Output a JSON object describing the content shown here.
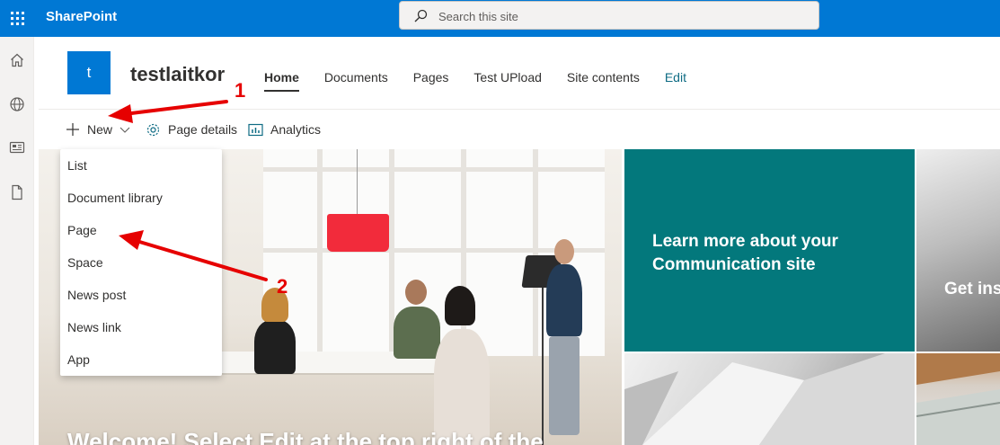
{
  "suitebar": {
    "app_name": "SharePoint",
    "search_placeholder": "Search this site",
    "waffle_icon": "app-launcher-icon"
  },
  "appbar": {
    "items": [
      "home-icon",
      "globe-icon",
      "news-icon",
      "file-icon"
    ]
  },
  "site": {
    "logo_letter": "t",
    "title": "testlaitkor"
  },
  "nav": {
    "items": [
      "Home",
      "Documents",
      "Pages",
      "Test UPload",
      "Site contents"
    ],
    "active": "Home",
    "edit_label": "Edit"
  },
  "commandbar": {
    "new_label": "New",
    "page_details_label": "Page details",
    "analytics_label": "Analytics"
  },
  "new_menu": {
    "items": [
      "List",
      "Document library",
      "Page",
      "Space",
      "News post",
      "News link",
      "App"
    ]
  },
  "hero": {
    "main_caption": "Welcome! Select Edit at the top right of the",
    "tile_communication": "Learn more about your Communication site",
    "tile_insights": "Get insights SharePoint"
  },
  "annotations": {
    "step1": "1",
    "step2": "2",
    "color": "#e60000"
  },
  "colors": {
    "suite_blue": "#0078d4",
    "teal_tile": "#03787c",
    "edit_link": "#0f6c84"
  }
}
